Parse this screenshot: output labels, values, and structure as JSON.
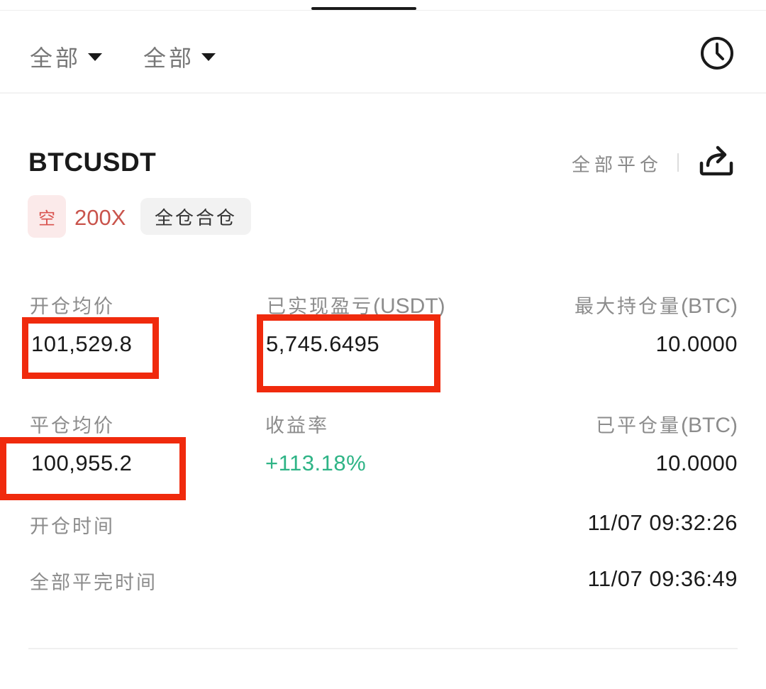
{
  "filters": {
    "first": "全部",
    "second": "全部"
  },
  "position": {
    "symbol": "BTCUSDT",
    "close_all_label": "全部平仓",
    "side_tag": "空",
    "leverage": "200X",
    "margin_mode": "全仓合仓"
  },
  "fields": {
    "open_avg_price_label": "开仓均价",
    "open_avg_price": "101,529.8",
    "realized_pnl_label": "已实现盈亏",
    "realized_pnl_unit": "(USDT)",
    "realized_pnl": "5,745.6495",
    "max_position_label": "最大持仓量",
    "max_position_unit": "(BTC)",
    "max_position": "10.0000",
    "close_avg_price_label": "平仓均价",
    "close_avg_price": "100,955.2",
    "return_rate_label": "收益率",
    "return_rate": "+113.18%",
    "closed_amount_label": "已平仓量",
    "closed_amount_unit": "(BTC)",
    "closed_amount": "10.0000",
    "open_time_label": "开仓时间",
    "open_time": "11/07 09:32:26",
    "full_close_time_label": "全部平完时间",
    "full_close_time": "11/07 09:36:49"
  },
  "icons": {
    "history": "clock-icon",
    "share": "share-icon",
    "dropdown": "caret-down-icon"
  },
  "colors": {
    "short": "#d9534f",
    "profit": "#2fb486",
    "highlight": "#f02a0d"
  }
}
